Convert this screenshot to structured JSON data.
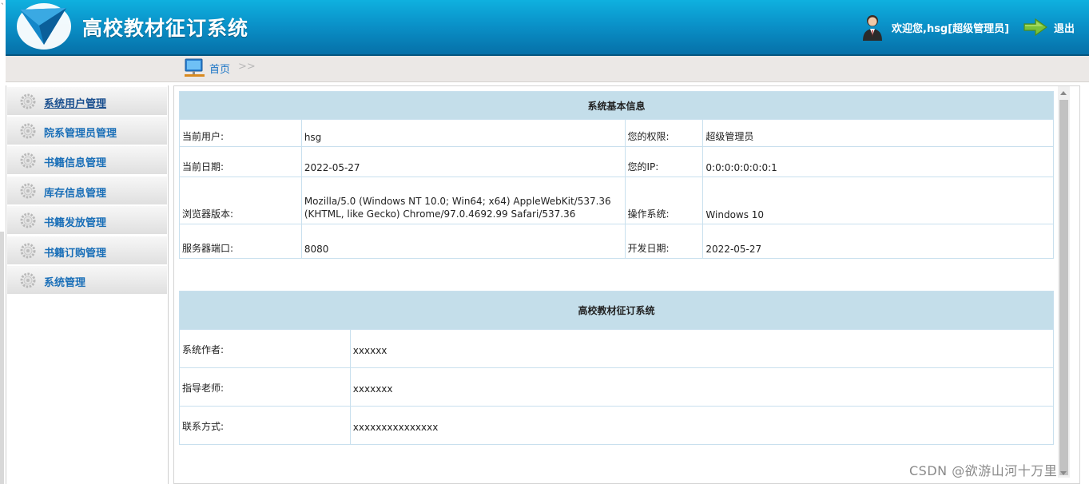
{
  "header": {
    "title": "高校教材征订系统",
    "welcome": "欢迎您,hsg[超级管理员]",
    "logout_label": "退出"
  },
  "breadcrumb": {
    "home": "首页",
    "separator": ">>"
  },
  "sidebar": {
    "items": [
      {
        "label": "系统用户管理",
        "active": true
      },
      {
        "label": "院系管理员管理"
      },
      {
        "label": "书籍信息管理"
      },
      {
        "label": "库存信息管理"
      },
      {
        "label": "书籍发放管理"
      },
      {
        "label": "书籍订购管理"
      },
      {
        "label": "系统管理"
      }
    ]
  },
  "sysinfo": {
    "title": "系统基本信息",
    "current_user_label": "当前用户:",
    "current_user": "hsg",
    "permission_label": "您的权限:",
    "permission": "超级管理员",
    "date_label": "当前日期:",
    "date": "2022-05-27",
    "ip_label": "您的IP:",
    "ip": "0:0:0:0:0:0:0:1",
    "browser_label": "浏览器版本:",
    "browser_line1": "Mozilla/5.0 (Windows NT 10.0; Win64; x64) AppleWebKit/537.36",
    "browser_line2": "(KHTML, like Gecko) Chrome/97.0.4692.99 Safari/537.36",
    "os_label": "操作系统:",
    "os": "Windows 10",
    "port_label": "服务器端口:",
    "port": "8080",
    "dev_date_label": "开发日期:",
    "dev_date": "2022-05-27"
  },
  "about": {
    "title": "高校教材征订系统",
    "author_label": "系统作者:",
    "author": "xxxxxx",
    "teacher_label": "指导老师:",
    "teacher": "xxxxxxx",
    "contact_label": "联系方式:",
    "contact": "xxxxxxxxxxxxxxx"
  },
  "watermark": "CSDN @欲游山河十万里",
  "colors": {
    "header_top": "#0fb1df",
    "header_bottom": "#0670a8",
    "table_head": "#c4deea",
    "menu_text": "#1a6fb8"
  },
  "icons": {
    "logo": "paper-plane-logo",
    "avatar": "user-icon",
    "logout": "green-arrow-icon",
    "breadcrumb": "monitor-icon",
    "menu": "gear-icon"
  }
}
